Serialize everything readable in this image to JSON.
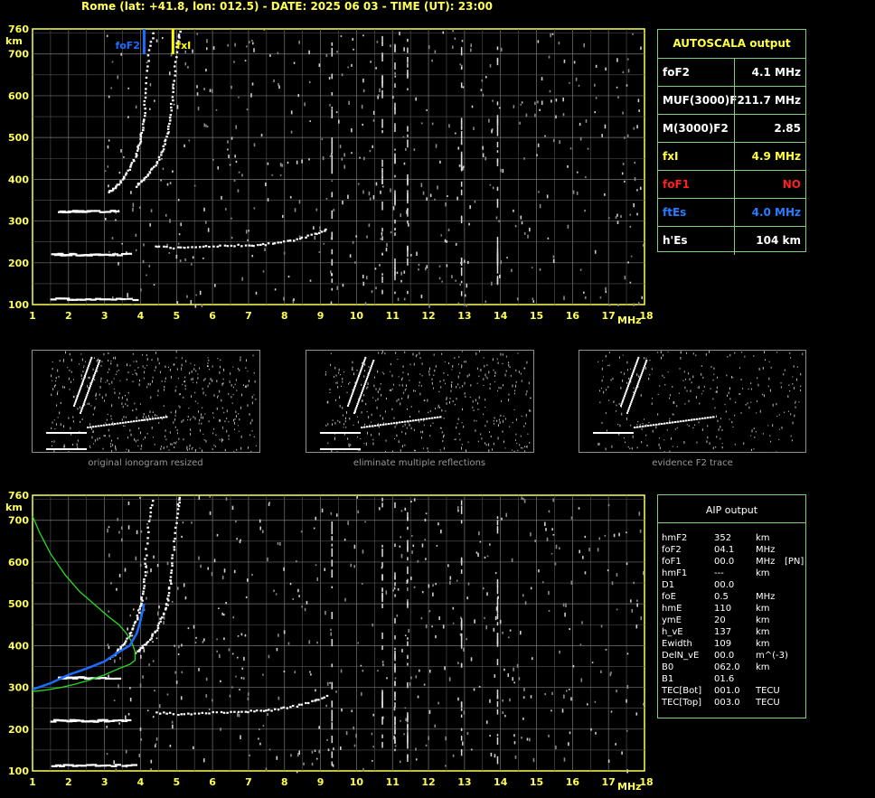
{
  "header": "Rome (lat: +41.8, lon: 012.5) - DATE: 2025 06 03 - TIME (UT): 23:00",
  "colors": {
    "axis": "#ffff55",
    "grid": "#777777",
    "white": "#ffffff",
    "yellow": "#ffff00",
    "blue": "#1b6dff",
    "red": "#ff2020",
    "green": "#22dd22",
    "panel_border": "#7fcf7f"
  },
  "chart_data": [
    {
      "type": "scatter",
      "name_tag": "main-ionogram",
      "xlabel": "MHz",
      "ylabel": "km",
      "xlim": [
        1,
        18
      ],
      "ylim": [
        100,
        760
      ],
      "x_ticks": [
        1,
        2,
        3,
        4,
        5,
        6,
        7,
        8,
        9,
        10,
        11,
        12,
        13,
        14,
        15,
        16,
        17,
        18
      ],
      "y_ticks": [
        100,
        200,
        300,
        400,
        500,
        600,
        700,
        760
      ],
      "markers": [
        {
          "label": "foF2",
          "x": 4.1,
          "color": "#1b6dff"
        },
        {
          "label": "fxI",
          "x": 4.9,
          "color": "#ffff00"
        }
      ],
      "traces": [
        {
          "name": "O-mode F2",
          "points": [
            [
              3.1,
              370
            ],
            [
              3.3,
              385
            ],
            [
              3.5,
              405
            ],
            [
              3.7,
              430
            ],
            [
              3.85,
              460
            ],
            [
              3.95,
              490
            ],
            [
              4.02,
              520
            ],
            [
              4.08,
              560
            ],
            [
              4.12,
              620
            ],
            [
              4.2,
              700
            ],
            [
              4.35,
              760
            ]
          ]
        },
        {
          "name": "X-mode F2",
          "points": [
            [
              3.85,
              385
            ],
            [
              4.05,
              400
            ],
            [
              4.25,
              420
            ],
            [
              4.45,
              445
            ],
            [
              4.6,
              475
            ],
            [
              4.72,
              510
            ],
            [
              4.8,
              550
            ],
            [
              4.86,
              600
            ],
            [
              4.92,
              660
            ],
            [
              5.0,
              730
            ],
            [
              5.08,
              760
            ]
          ]
        },
        {
          "name": "Es",
          "points": [
            [
              1.5,
              222
            ],
            [
              2.0,
              222
            ],
            [
              2.5,
              222
            ],
            [
              3.0,
              222
            ],
            [
              3.7,
              222
            ]
          ]
        },
        {
          "name": "Es second hop",
          "points": [
            [
              1.5,
              115
            ],
            [
              2.2,
              115
            ],
            [
              3.0,
              115
            ],
            [
              3.9,
              115
            ]
          ]
        },
        {
          "name": "Es multiple",
          "points": [
            [
              1.7,
              325
            ],
            [
              2.1,
              325
            ],
            [
              2.6,
              325
            ],
            [
              3.4,
              325
            ]
          ]
        },
        {
          "name": "spread",
          "points": [
            [
              4.4,
              242
            ],
            [
              5.0,
              238
            ],
            [
              5.6,
              240
            ],
            [
              6.2,
              242
            ],
            [
              6.8,
              244
            ],
            [
              7.3,
              245
            ],
            [
              7.8,
              250
            ],
            [
              8.3,
              258
            ],
            [
              8.8,
              270
            ],
            [
              9.2,
              282
            ]
          ]
        }
      ]
    },
    {
      "type": "scatter",
      "name_tag": "aip-ionogram",
      "xlabel": "MHz",
      "ylabel": "km",
      "xlim": [
        1,
        18
      ],
      "ylim": [
        100,
        760
      ],
      "x_ticks": [
        1,
        2,
        3,
        4,
        5,
        6,
        7,
        8,
        9,
        10,
        11,
        12,
        13,
        14,
        15,
        16,
        17,
        18
      ],
      "y_ticks": [
        100,
        200,
        300,
        400,
        500,
        600,
        700,
        760
      ],
      "profile_green": [
        [
          1.0,
          710
        ],
        [
          1.2,
          670
        ],
        [
          1.5,
          620
        ],
        [
          1.9,
          570
        ],
        [
          2.3,
          530
        ],
        [
          2.7,
          500
        ],
        [
          3.1,
          470
        ],
        [
          3.4,
          450
        ],
        [
          3.6,
          430
        ],
        [
          3.75,
          410
        ],
        [
          3.85,
          385
        ],
        [
          3.85,
          365
        ],
        [
          3.7,
          355
        ],
        [
          3.4,
          345
        ],
        [
          3.0,
          330
        ],
        [
          2.6,
          318
        ],
        [
          2.2,
          308
        ],
        [
          1.8,
          300
        ],
        [
          1.4,
          294
        ],
        [
          1.0,
          290
        ]
      ],
      "profile_blue": [
        [
          1.0,
          295
        ],
        [
          1.5,
          310
        ],
        [
          2.0,
          330
        ],
        [
          2.5,
          345
        ],
        [
          3.0,
          362
        ],
        [
          3.4,
          385
        ],
        [
          3.7,
          400
        ],
        [
          3.9,
          430
        ],
        [
          4.0,
          460
        ],
        [
          4.1,
          500
        ]
      ]
    }
  ],
  "autoscala": {
    "title": "AUTOSCALA output",
    "rows": [
      {
        "label": "foF2",
        "value": "4.1 MHz",
        "color": "#ffffff"
      },
      {
        "label": "MUF(3000)F2",
        "value": "11.7 MHz",
        "color": "#ffffff"
      },
      {
        "label": "M(3000)F2",
        "value": "2.85",
        "color": "#ffffff"
      },
      {
        "label": "fxI",
        "value": "4.9 MHz",
        "color": "#ffff44"
      },
      {
        "label": "foF1",
        "value": "NO",
        "color": "#ff2020"
      },
      {
        "label": "ftEs",
        "value": "4.0 MHz",
        "color": "#2a7bff"
      },
      {
        "label": "h'Es",
        "value": "104    km",
        "color": "#ffffff"
      }
    ]
  },
  "thumbnails": [
    {
      "caption": "original ionogram resized"
    },
    {
      "caption": "eliminate multiple reflections"
    },
    {
      "caption": "evidence F2 trace"
    }
  ],
  "aip": {
    "title": "AIP output",
    "rows": [
      {
        "name": "hmF2",
        "value": "352",
        "unit": "km",
        "extra": ""
      },
      {
        "name": "foF2",
        "value": "04.1",
        "unit": "MHz",
        "extra": ""
      },
      {
        "name": "foF1",
        "value": "00.0",
        "unit": "MHz",
        "extra": "[PN]"
      },
      {
        "name": "hmF1",
        "value": "---",
        "unit": "km",
        "extra": ""
      },
      {
        "name": "D1",
        "value": "00.0",
        "unit": "",
        "extra": ""
      },
      {
        "name": "foE",
        "value": "0.5",
        "unit": "MHz",
        "extra": ""
      },
      {
        "name": "hmE",
        "value": "110",
        "unit": "km",
        "extra": ""
      },
      {
        "name": "ymE",
        "value": "20",
        "unit": "km",
        "extra": ""
      },
      {
        "name": "h_vE",
        "value": "137",
        "unit": "km",
        "extra": ""
      },
      {
        "name": "Ewidth",
        "value": "109",
        "unit": "km",
        "extra": ""
      },
      {
        "name": "DelN_vE",
        "value": "00.0",
        "unit": "m^(-3)",
        "extra": ""
      },
      {
        "name": "B0",
        "value": "062.0",
        "unit": "km",
        "extra": ""
      },
      {
        "name": "B1",
        "value": "01.6",
        "unit": "",
        "extra": ""
      },
      {
        "name": "TEC[Bot]",
        "value": "001.0",
        "unit": "TECU",
        "extra": ""
      },
      {
        "name": "TEC[Top]",
        "value": "003.0",
        "unit": "TECU",
        "extra": ""
      }
    ]
  }
}
